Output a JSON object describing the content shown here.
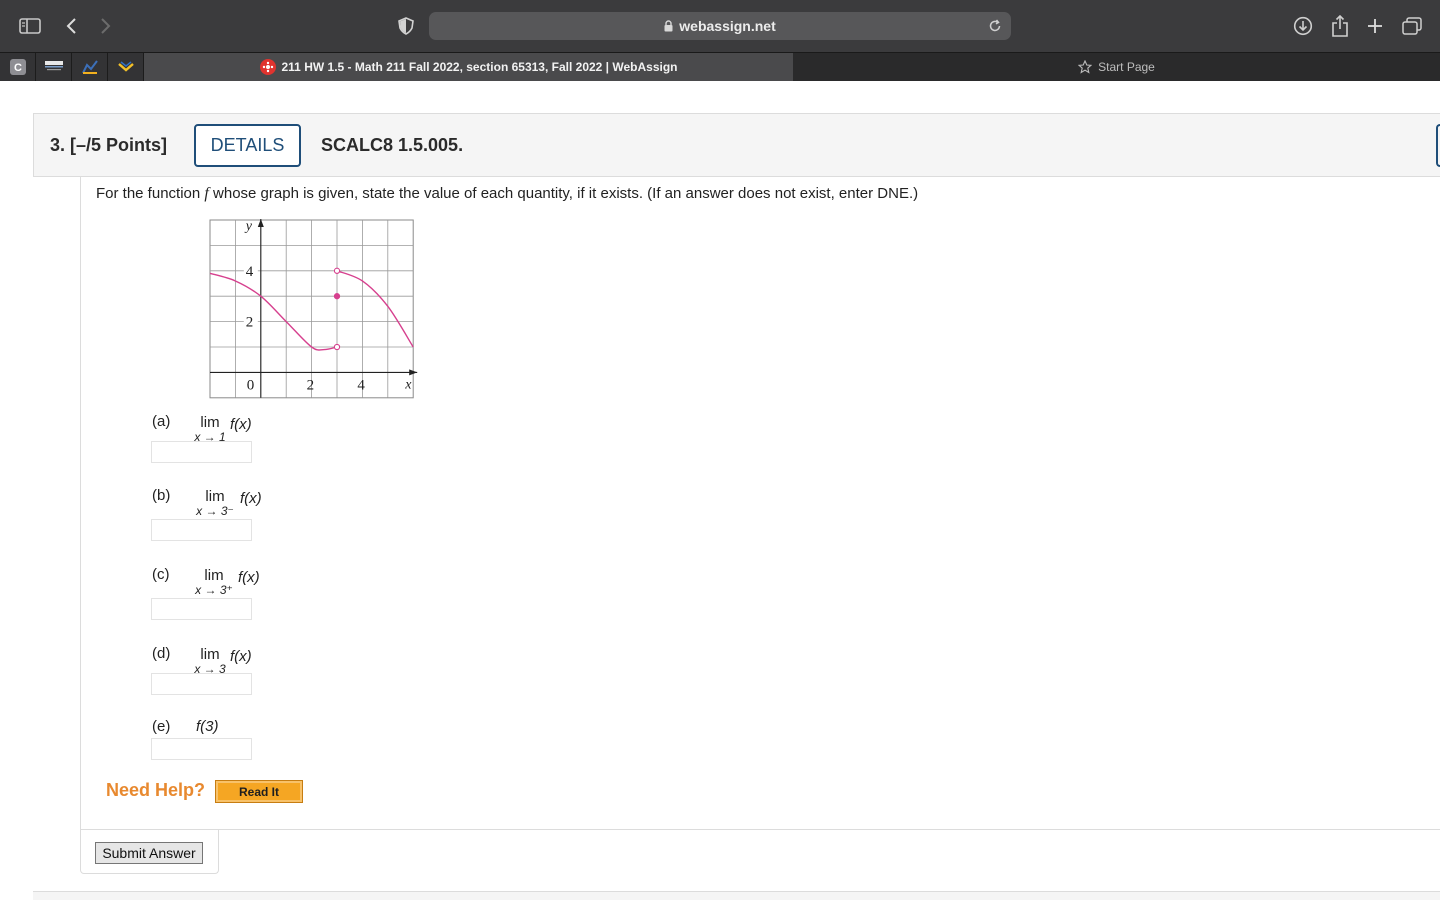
{
  "browser": {
    "url": "webassign.net",
    "tabs": [
      {
        "title": "211 HW 1.5 - Math 211 Fall 2022, section 65313, Fall 2022 | WebAssign",
        "active": true,
        "favicon": "webassign-icon"
      },
      {
        "title": "Start Page",
        "active": false,
        "favicon": "star-icon"
      }
    ],
    "pinned_tabs": [
      "pinned-c-icon",
      "pinned-flag-icon",
      "pinned-chart-icon",
      "pinned-chevron-icon"
    ],
    "icons": [
      "sidebar-icon",
      "back-icon",
      "forward-icon",
      "privacy-shield-icon",
      "lock-icon",
      "reload-icon",
      "download-icon",
      "share-icon",
      "new-tab-icon",
      "tab-overview-icon"
    ]
  },
  "question": {
    "number_points": "3.  [–/5 Points]",
    "details_label": "DETAILS",
    "code": "SCALC8 1.5.005.",
    "prompt_before": "For the function ",
    "prompt_var": "f",
    "prompt_after": " whose graph is given, state the value of each quantity, if it exists. (If an answer does not exist, enter DNE.)",
    "parts": [
      {
        "label": "(a)",
        "word": "lim",
        "sub": "x → 1",
        "expr": "f(x)",
        "value": ""
      },
      {
        "label": "(b)",
        "word": "lim",
        "sub": "x → 3⁻",
        "expr": "f(x)",
        "value": ""
      },
      {
        "label": "(c)",
        "word": "lim",
        "sub": "x → 3⁺",
        "expr": "f(x)",
        "value": ""
      },
      {
        "label": "(d)",
        "word": "lim",
        "sub": "x → 3",
        "expr": "f(x)",
        "value": ""
      },
      {
        "label": "(e)",
        "word": "",
        "sub": "",
        "expr": "f(3)",
        "value": ""
      }
    ],
    "need_help": "Need Help?",
    "read_it": "Read It",
    "submit": "Submit Answer"
  },
  "chart_data": {
    "type": "line",
    "title": "",
    "xlabel": "x",
    "ylabel": "y",
    "xlim": [
      -2,
      6
    ],
    "ylim": [
      -1,
      6
    ],
    "x_ticks": [
      0,
      2,
      4
    ],
    "y_ticks": [
      2,
      4
    ],
    "grid": true,
    "series": [
      {
        "points": [
          [
            -2,
            3.9
          ],
          [
            -1,
            3.6
          ],
          [
            0,
            3
          ],
          [
            1,
            2
          ],
          [
            2,
            1
          ],
          [
            2.5,
            0.9
          ],
          [
            3,
            1
          ]
        ],
        "end": "open"
      },
      {
        "points": [
          [
            3,
            4
          ],
          [
            4,
            3.6
          ],
          [
            5,
            2.6
          ],
          [
            6,
            1
          ]
        ],
        "start": "open"
      }
    ],
    "markers": [
      {
        "x": 3,
        "y": 1,
        "style": "open"
      },
      {
        "x": 3,
        "y": 4,
        "style": "open"
      },
      {
        "x": 3,
        "y": 3,
        "style": "filled"
      }
    ],
    "curve_color": "#d6408e"
  }
}
